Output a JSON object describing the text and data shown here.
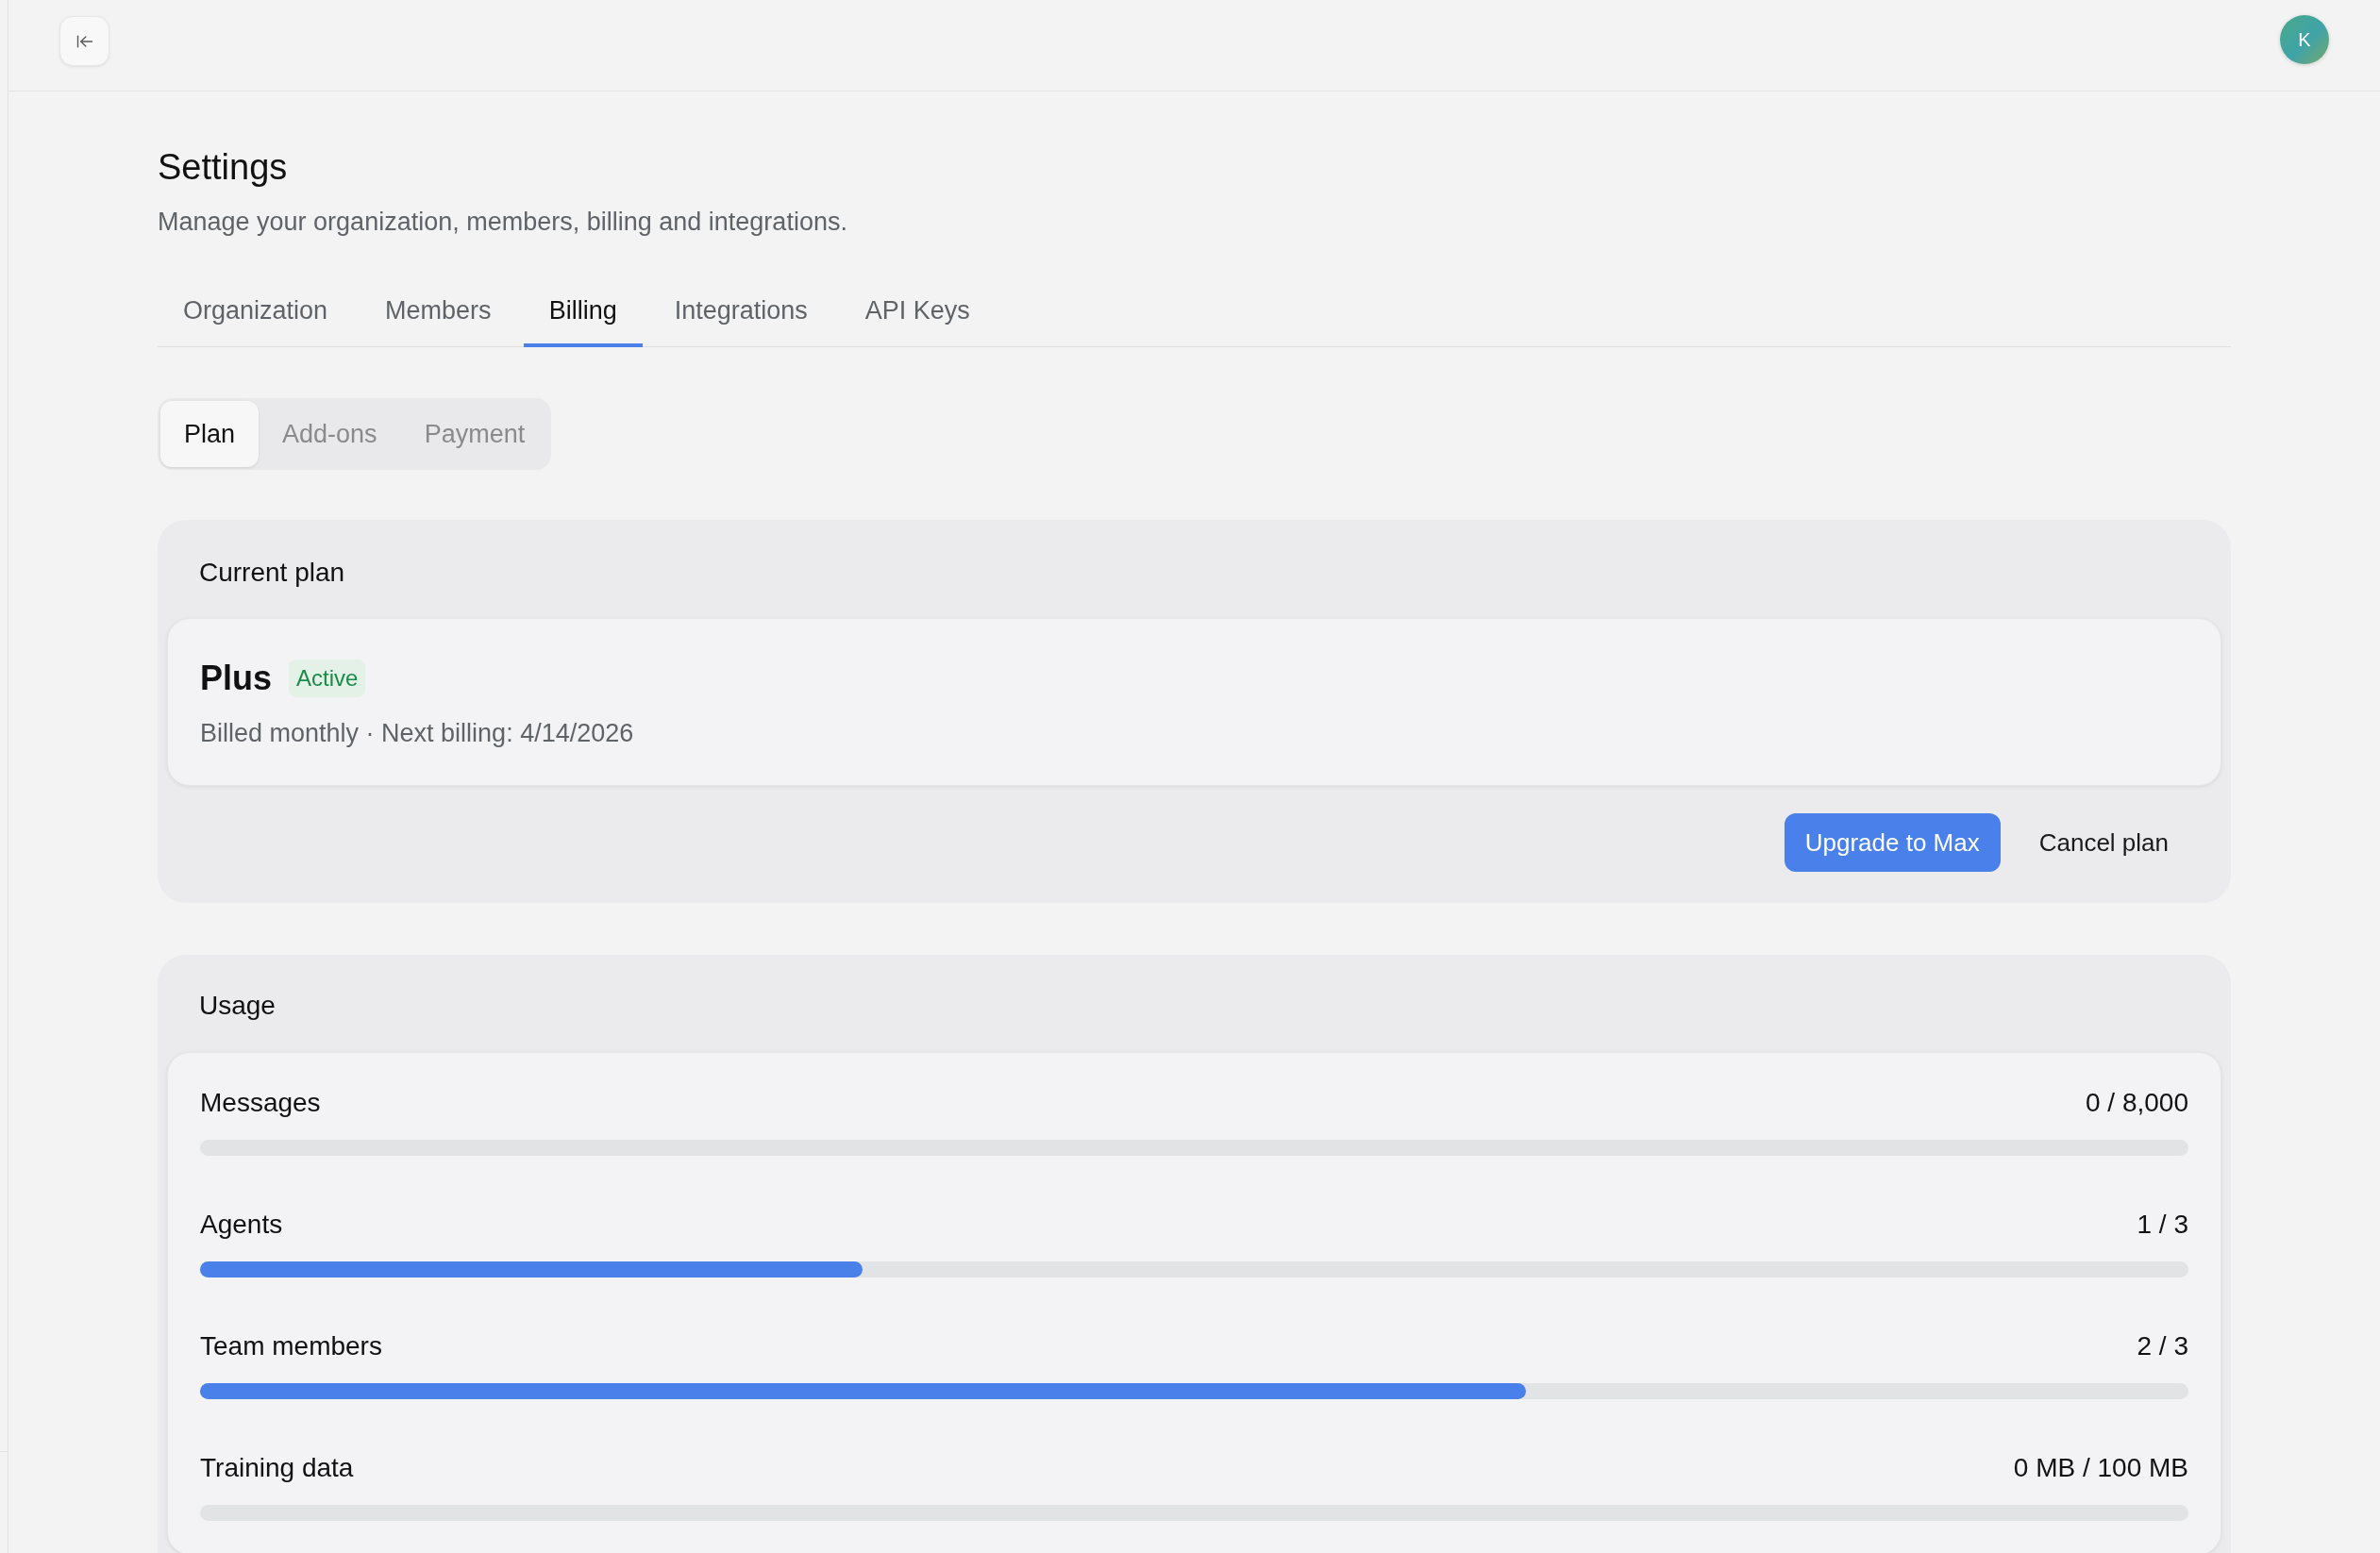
{
  "header": {
    "avatar_initial": "K"
  },
  "page": {
    "title": "Settings",
    "subtitle": "Manage your organization, members, billing and integrations."
  },
  "tabs": [
    {
      "label": "Organization",
      "selected": false
    },
    {
      "label": "Members",
      "selected": false
    },
    {
      "label": "Billing",
      "selected": true
    },
    {
      "label": "Integrations",
      "selected": false
    },
    {
      "label": "API Keys",
      "selected": false
    }
  ],
  "subtabs": [
    {
      "label": "Plan",
      "selected": true
    },
    {
      "label": "Add-ons",
      "selected": false
    },
    {
      "label": "Payment",
      "selected": false
    }
  ],
  "current_plan": {
    "heading": "Current plan",
    "plan_name": "Plus",
    "status": "Active",
    "billing_info": "Billed monthly · Next billing: 4/14/2026",
    "actions": [
      {
        "label": "Upgrade to Max",
        "kind": "primary"
      },
      {
        "label": "Cancel plan",
        "kind": "ghost"
      }
    ]
  },
  "usage": {
    "heading": "Usage",
    "meters": [
      {
        "name": "Messages",
        "reading": "0 / 8,000"
      },
      {
        "name": "Agents",
        "reading": "1 / 3",
        "level": 0.3333
      },
      {
        "name": "Team members",
        "reading": "2 / 3",
        "level": 0.6667
      },
      {
        "name": "Training data",
        "reading": "0 MB / 100 MB"
      }
    ]
  }
}
